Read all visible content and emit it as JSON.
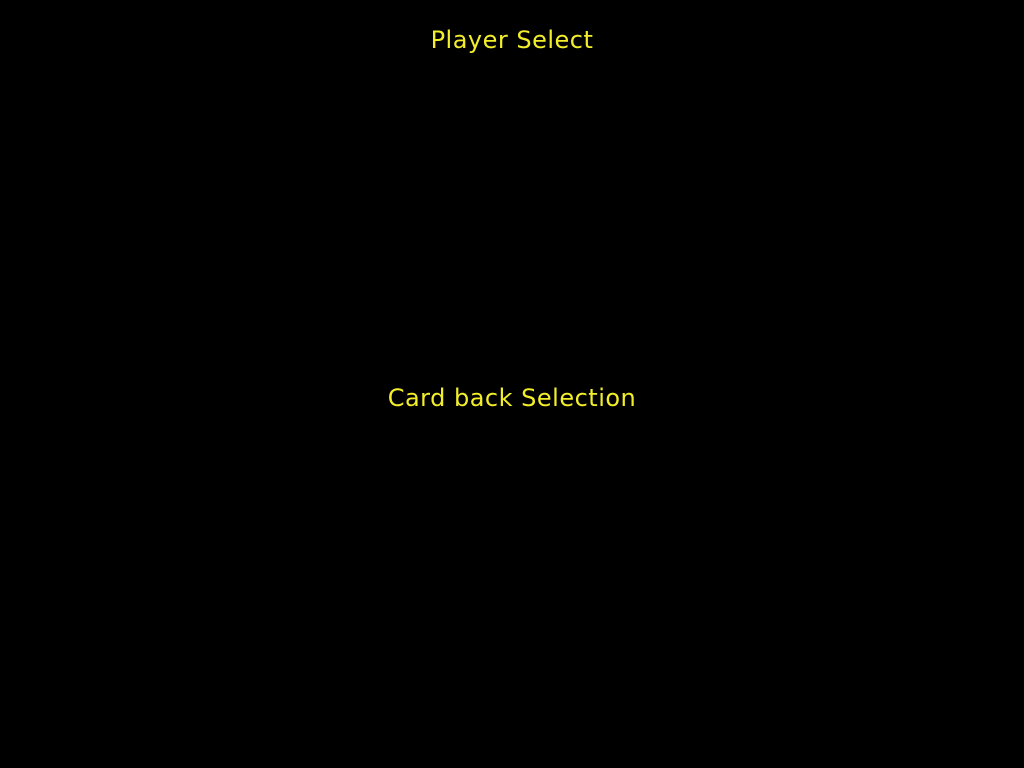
{
  "screen": {
    "background_color": "#000000",
    "text_color": "#f2ee2a"
  },
  "player_select": {
    "heading": "Player Select"
  },
  "card_back": {
    "heading": "Card back Selection"
  }
}
